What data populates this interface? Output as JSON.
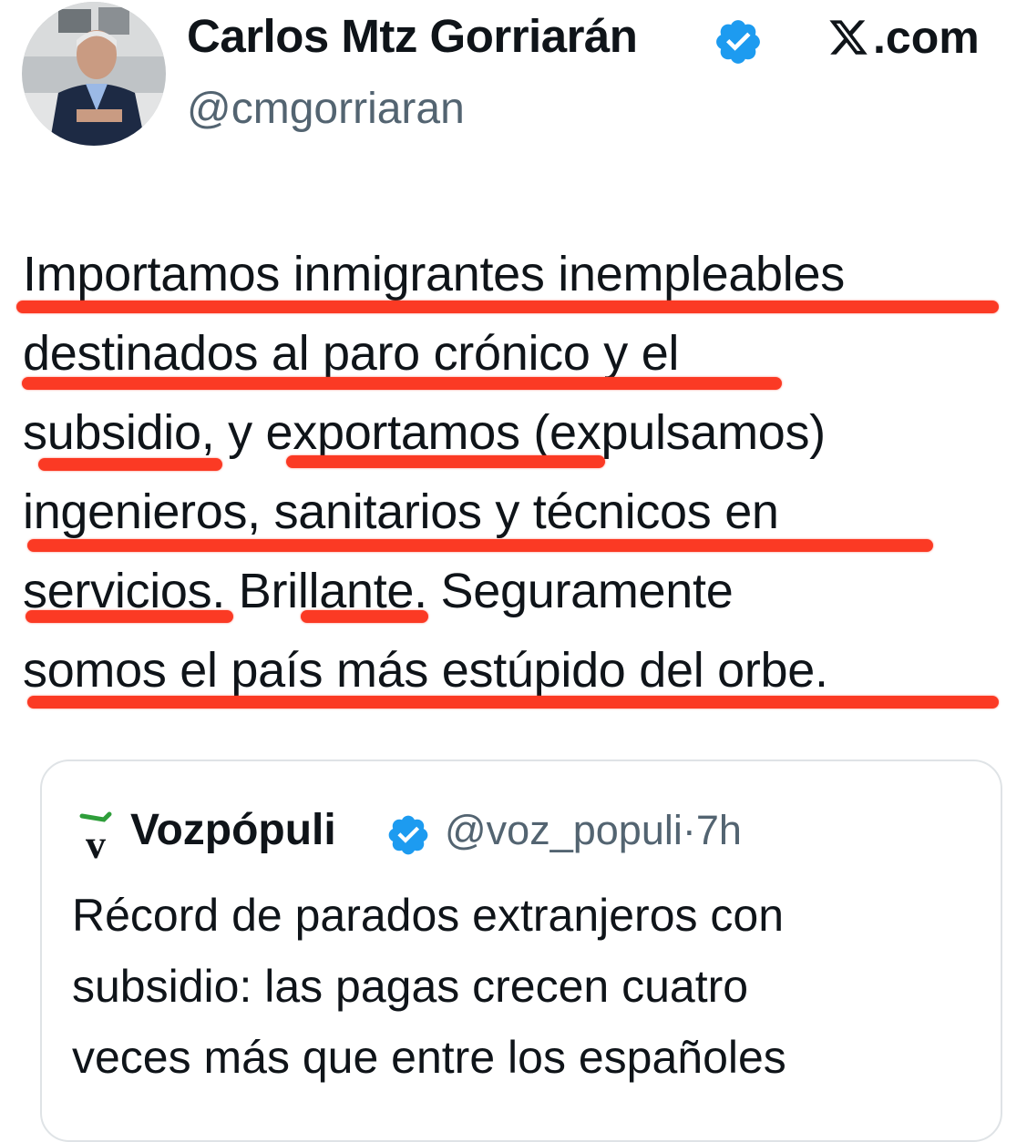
{
  "tweet": {
    "author": {
      "name": "Carlos Mtz Gorriarán",
      "handle": "@cmgorriaran",
      "verified": true
    },
    "brand": ".com",
    "brand_icon": "x-logo-icon",
    "text_lines": [
      "Importamos inmigrantes inempleables",
      "destinados al paro crónico y el",
      "subsidio, y exportamos (expulsamos)",
      "ingenieros, sanitarios y técnicos en",
      "servicios. Brillante. Seguramente",
      "somos el país más estúpido del orbe."
    ],
    "underline_color": "#fb3a24"
  },
  "quoted": {
    "name": "Vozpópuli",
    "handle": "@voz_populi",
    "time": "7h",
    "separator": "·",
    "logo_icon": "vozpopuli-logo-icon",
    "verified": true,
    "text_lines": [
      "Récord de parados extranjeros con",
      "subsidio: las pagas crecen cuatro",
      "veces más que entre los españoles"
    ]
  },
  "colors": {
    "verified_blue": "#1d9bf0",
    "text": "#0f1419",
    "secondary": "#536471",
    "highlight": "#fb3a24"
  }
}
